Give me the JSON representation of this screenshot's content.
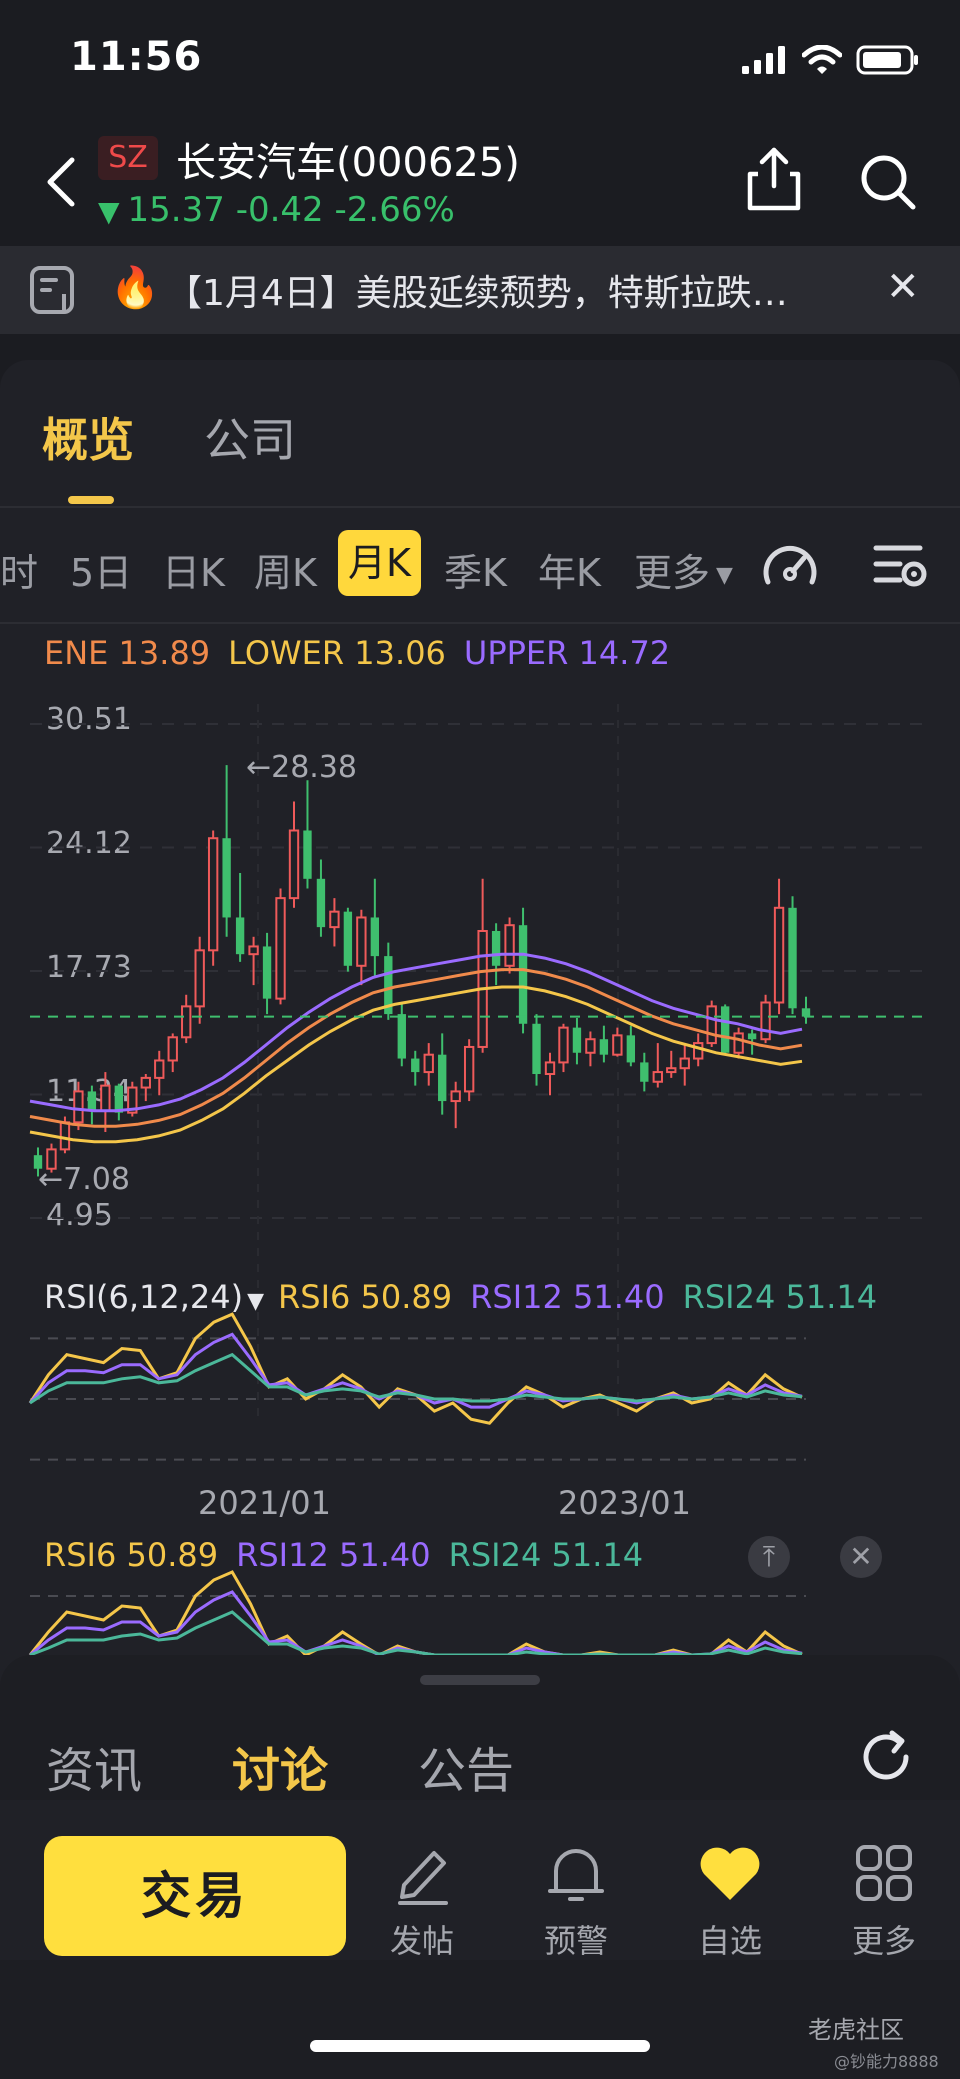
{
  "status_bar": {
    "time": "11:56"
  },
  "header": {
    "market": "SZ",
    "stock_name": "长安汽车(000625)",
    "price": "15.37",
    "change": "-0.42",
    "change_pct": "-2.66%",
    "direction_arrow": "▼"
  },
  "news": {
    "icon": "fire-icon",
    "text": "【1月4日】美股延续颓势，特斯拉跌…",
    "close": "✕"
  },
  "main_tabs": [
    "概览",
    "公司"
  ],
  "periods": [
    "时",
    "5日",
    "日K",
    "周K",
    "月K",
    "季K",
    "年K",
    "更多"
  ],
  "active_period": "月K",
  "indicator": {
    "ene": "ENE 13.89",
    "lower": "LOWER 13.06",
    "upper": "UPPER 14.72"
  },
  "y_axis": {
    "labels": [
      "30.51",
      "24.12",
      "17.73",
      "11.34",
      "4.95"
    ],
    "max_label": "←28.38",
    "min_label": "←7.08"
  },
  "rsi": {
    "name": "RSI(6,12,24)",
    "caret": "▼",
    "rsi6": "RSI6 50.89",
    "rsi12": "RSI12 51.40",
    "rsi24": "RSI24 51.14"
  },
  "x_axis": {
    "labels": [
      "2021/01",
      "2023/01"
    ]
  },
  "rsi_panel2": {
    "rsi6": "RSI6 50.89",
    "rsi12": "RSI12 51.40",
    "rsi24": "RSI24 51.14",
    "pin": "⤒",
    "close": "✕"
  },
  "sheet_tabs": [
    "资讯",
    "讨论",
    "公告"
  ],
  "active_sheet_tab": "讨论",
  "actions": {
    "trade": "交易",
    "post": "发帖",
    "alert": "预警",
    "watchlist": "自选",
    "more": "更多"
  },
  "watermark": {
    "brand": "老虎社区",
    "user": "@钞能力8888"
  },
  "colors": {
    "accent": "#f4c74a",
    "up": "#ef5a5a",
    "down": "#3fbf6e",
    "ene": "#f08a4b",
    "lower": "#f4c64a",
    "upper": "#9a6bff",
    "rsi24": "#4bb89a"
  },
  "chart_data": {
    "type": "candlestick",
    "period": "monthly",
    "ylim": [
      4.95,
      30.51
    ],
    "yticks": [
      30.51,
      24.12,
      17.73,
      11.34,
      4.95
    ],
    "current_price": 15.37,
    "annotations": {
      "max": 28.38,
      "min": 7.08
    },
    "x_tick_labels": [
      "2021/01",
      "2023/01"
    ],
    "candles": [
      [
        8.2,
        8.6,
        7.1,
        7.5
      ],
      [
        7.5,
        8.8,
        7.3,
        8.5
      ],
      [
        8.5,
        10.2,
        8.3,
        9.9
      ],
      [
        9.9,
        12.0,
        9.5,
        11.5
      ],
      [
        11.5,
        11.8,
        9.8,
        10.5
      ],
      [
        10.5,
        12.5,
        9.4,
        11.8
      ],
      [
        11.8,
        11.9,
        10.0,
        10.4
      ],
      [
        10.4,
        12.0,
        10.2,
        11.7
      ],
      [
        11.7,
        12.4,
        11.0,
        12.2
      ],
      [
        12.2,
        13.6,
        11.3,
        13.1
      ],
      [
        13.1,
        14.5,
        12.5,
        14.3
      ],
      [
        14.3,
        16.5,
        14.0,
        15.9
      ],
      [
        15.9,
        19.5,
        15.0,
        18.8
      ],
      [
        18.8,
        25.0,
        18.0,
        24.6
      ],
      [
        24.6,
        28.38,
        19.5,
        20.5
      ],
      [
        20.5,
        22.8,
        18.2,
        18.6
      ],
      [
        18.6,
        19.5,
        17.0,
        19.0
      ],
      [
        19.0,
        19.7,
        15.5,
        16.3
      ],
      [
        16.3,
        22.0,
        16.0,
        21.5
      ],
      [
        21.5,
        26.5,
        21.0,
        25.0
      ],
      [
        25.0,
        27.6,
        22.0,
        22.5
      ],
      [
        22.5,
        23.5,
        19.5,
        20.0
      ],
      [
        20.0,
        21.5,
        19.0,
        20.8
      ],
      [
        20.8,
        21.0,
        17.7,
        18.0
      ],
      [
        18.0,
        20.9,
        17.0,
        20.5
      ],
      [
        20.5,
        22.5,
        17.5,
        18.5
      ],
      [
        18.5,
        19.2,
        15.2,
        15.5
      ],
      [
        15.5,
        16.0,
        12.8,
        13.2
      ],
      [
        13.2,
        13.6,
        11.8,
        12.5
      ],
      [
        12.5,
        14.0,
        11.8,
        13.4
      ],
      [
        13.4,
        14.5,
        10.3,
        11.0
      ],
      [
        11.0,
        12.0,
        9.6,
        11.5
      ],
      [
        11.5,
        14.2,
        11.0,
        13.8
      ],
      [
        13.8,
        22.5,
        13.5,
        19.8
      ],
      [
        19.8,
        20.2,
        17.0,
        18.0
      ],
      [
        18.0,
        20.5,
        17.6,
        20.1
      ],
      [
        20.1,
        21.0,
        14.5,
        15.0
      ],
      [
        15.0,
        15.5,
        11.8,
        12.4
      ],
      [
        12.4,
        13.5,
        11.3,
        13.0
      ],
      [
        13.0,
        15.0,
        12.5,
        14.8
      ],
      [
        14.8,
        15.3,
        12.9,
        13.5
      ],
      [
        13.5,
        14.6,
        12.8,
        14.2
      ],
      [
        14.2,
        14.9,
        13.0,
        13.4
      ],
      [
        13.4,
        14.8,
        13.3,
        14.4
      ],
      [
        14.4,
        14.9,
        12.8,
        13.0
      ],
      [
        13.0,
        13.5,
        11.5,
        12.0
      ],
      [
        12.0,
        14.0,
        11.7,
        12.5
      ],
      [
        12.5,
        13.6,
        12.2,
        12.7
      ],
      [
        12.7,
        14.0,
        11.8,
        13.2
      ],
      [
        13.2,
        14.5,
        12.8,
        14.0
      ],
      [
        14.0,
        16.2,
        13.8,
        15.9
      ],
      [
        15.9,
        16.0,
        13.4,
        13.5
      ],
      [
        13.5,
        14.8,
        13.2,
        14.5
      ],
      [
        14.5,
        14.7,
        13.4,
        14.2
      ],
      [
        14.2,
        16.5,
        14.0,
        16.1
      ],
      [
        16.1,
        22.5,
        15.5,
        21.0
      ],
      [
        21.0,
        21.6,
        15.5,
        15.8
      ],
      [
        15.8,
        16.4,
        15.0,
        15.37
      ]
    ],
    "series": [
      {
        "name": "ENE",
        "values": [
          10.2,
          10.0,
          9.8,
          9.7,
          9.7,
          9.8,
          10.0,
          10.3,
          10.8,
          11.4,
          12.2,
          13.1,
          14.0,
          14.8,
          15.5,
          16.1,
          16.6,
          16.9,
          17.1,
          17.3,
          17.5,
          17.7,
          17.8,
          17.8,
          17.6,
          17.3,
          16.9,
          16.4,
          15.9,
          15.4,
          15.0,
          14.7,
          14.4,
          14.2,
          13.9,
          13.7,
          13.89
        ]
      },
      {
        "name": "LOWER",
        "values": [
          9.4,
          9.2,
          9.0,
          8.9,
          8.9,
          9.0,
          9.2,
          9.5,
          10.0,
          10.6,
          11.4,
          12.3,
          13.1,
          13.9,
          14.6,
          15.2,
          15.7,
          16.0,
          16.2,
          16.4,
          16.6,
          16.8,
          16.9,
          16.9,
          16.7,
          16.4,
          16.0,
          15.5,
          15.0,
          14.5,
          14.1,
          13.8,
          13.5,
          13.3,
          13.1,
          12.9,
          13.06
        ]
      },
      {
        "name": "UPPER",
        "values": [
          11.0,
          10.8,
          10.6,
          10.5,
          10.5,
          10.6,
          10.8,
          11.1,
          11.6,
          12.2,
          13.0,
          13.9,
          14.8,
          15.6,
          16.3,
          16.9,
          17.4,
          17.7,
          17.9,
          18.1,
          18.3,
          18.5,
          18.6,
          18.6,
          18.4,
          18.1,
          17.7,
          17.2,
          16.7,
          16.2,
          15.8,
          15.5,
          15.2,
          15.0,
          14.7,
          14.5,
          14.72
        ]
      }
    ],
    "rsi": {
      "ylim": [
        0,
        100
      ],
      "guides": [
        80,
        50,
        20
      ],
      "series": [
        {
          "name": "RSI6",
          "values": [
            48,
            62,
            72,
            70,
            68,
            75,
            74,
            60,
            63,
            80,
            88,
            92,
            76,
            56,
            60,
            50,
            55,
            62,
            56,
            46,
            55,
            52,
            44,
            48,
            40,
            38,
            48,
            56,
            52,
            46,
            50,
            52,
            48,
            44,
            50,
            53,
            48,
            50,
            58,
            52,
            62,
            55,
            50.89
          ]
        },
        {
          "name": "RSI12",
          "values": [
            48,
            58,
            64,
            64,
            63,
            67,
            67,
            60,
            62,
            72,
            78,
            82,
            70,
            57,
            58,
            52,
            55,
            58,
            55,
            50,
            54,
            52,
            48,
            50,
            46,
            46,
            50,
            54,
            52,
            49,
            50,
            51,
            50,
            48,
            50,
            52,
            50,
            51,
            55,
            52,
            57,
            53,
            51.4
          ]
        },
        {
          "name": "RSI24",
          "values": [
            48,
            54,
            58,
            58,
            58,
            60,
            61,
            58,
            59,
            64,
            68,
            72,
            64,
            56,
            56,
            52,
            54,
            55,
            54,
            51,
            53,
            52,
            50,
            50,
            49,
            49,
            50,
            52,
            51,
            50,
            50,
            51,
            50,
            49,
            50,
            51,
            50,
            51,
            53,
            51,
            54,
            52,
            51.14
          ]
        }
      ]
    }
  }
}
